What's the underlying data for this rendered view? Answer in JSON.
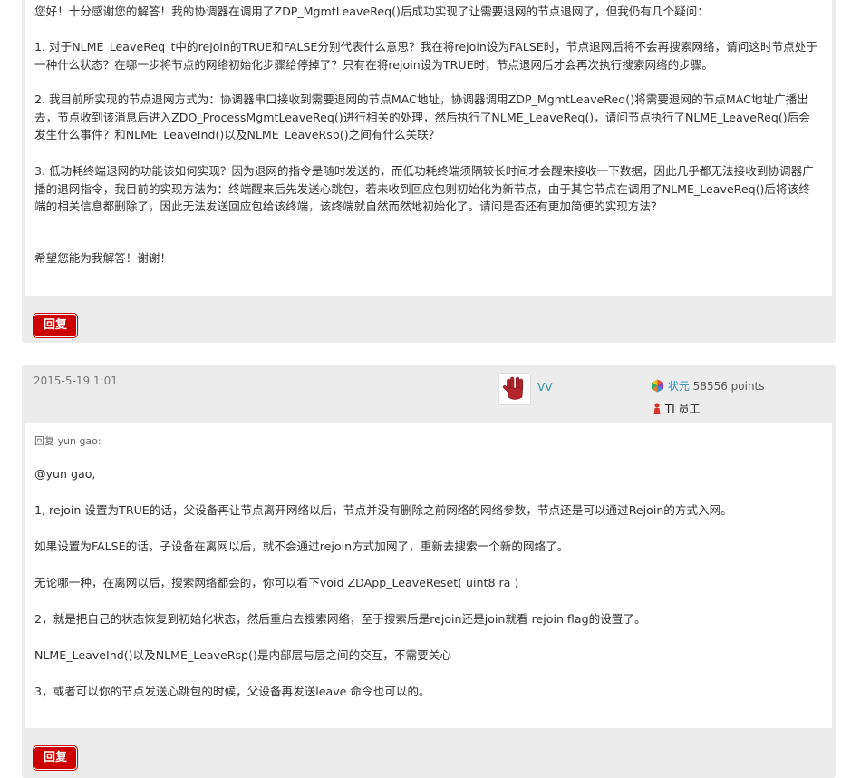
{
  "post1": {
    "paragraphs": [
      "您好！十分感谢您的解答！我的协调器在调用了ZDP_MgmtLeaveReq()后成功实现了让需要退网的节点退网了，但我仍有几个疑问：",
      "1. 对于NLME_LeaveReq_t中的rejoin的TRUE和FALSE分别代表什么意思？我在将rejoin设为FALSE时，节点退网后将不会再搜索网络，请问这时节点处于一种什么状态？在哪一步将节点的网络初始化步骤给停掉了？只有在将rejoin设为TRUE时，节点退网后才会再次执行搜索网络的步骤。",
      "2. 我目前所实现的节点退网方式为：协调器串口接收到需要退网的节点MAC地址，协调器调用ZDP_MgmtLeaveReq()将需要退网的节点MAC地址广播出去，节点收到该消息后进入ZDO_ProcessMgmtLeaveReq()进行相关的处理，然后执行了NLME_LeaveReq()，请问节点执行了NLME_LeaveReq()后会发生什么事件？和NLME_LeaveInd()以及NLME_LeaveRsp()之间有什么关联？",
      "3. 低功耗终端退网的功能该如何实现？因为退网的指令是随时发送的，而低功耗终端须隔较长时间才会醒来接收一下数据，因此几乎都无法接收到协调器广播的退网指令，我目前的实现方法为：终端醒来后先发送心跳包，若未收到回应包则初始化为新节点，由于其它节点在调用了NLME_LeaveReq()后将该终端的相关信息都删除了，因此无法发送回应包给该终端，该终端就自然而然地初始化了。请问是否还有更加简便的实现方法？",
      "希望您能为我解答！谢谢！"
    ],
    "reply_label": "回复"
  },
  "post2": {
    "date": "2015-5-19 1:01",
    "author": "VV",
    "rank_name": "状元",
    "points": "58556 points",
    "badge": "TI 员工",
    "reply_to": "回复 yun gao:",
    "paragraphs": [
      "@yun gao,",
      "1, rejoin 设置为TRUE的话，父设备再让节点离开网络以后，节点并没有删除之前网络的网络参数，节点还是可以通过Rejoin的方式入网。",
      "如果设置为FALSE的话，子设备在离网以后，就不会通过rejoin方式加网了，重新去搜索一个新的网络了。",
      "无论哪一种，在离网以后，搜索网络都会的，你可以看下void ZDApp_LeaveReset( uint8 ra )",
      "2，就是把自己的状态恢复到初始化状态，然后重启去搜索网络，至于搜索后是rejoin还是join就看 rejoin flag的设置了。",
      "NLME_LeaveInd()以及NLME_LeaveRsp()是内部层与层之间的交互，不需要关心",
      "3，或者可以你的节点发送心跳包的时候，父设备再发送leave 命令也可以的。"
    ],
    "reply_label": "回复"
  },
  "colors": {
    "reply_button": "#cc0000",
    "link": "#2b8fb0",
    "card_bg": "#ececec"
  },
  "icons": {
    "avatar": "vulcan-salute-hand-icon",
    "rank": "rank-diamond-icon",
    "badge": "ti-employee-icon"
  }
}
